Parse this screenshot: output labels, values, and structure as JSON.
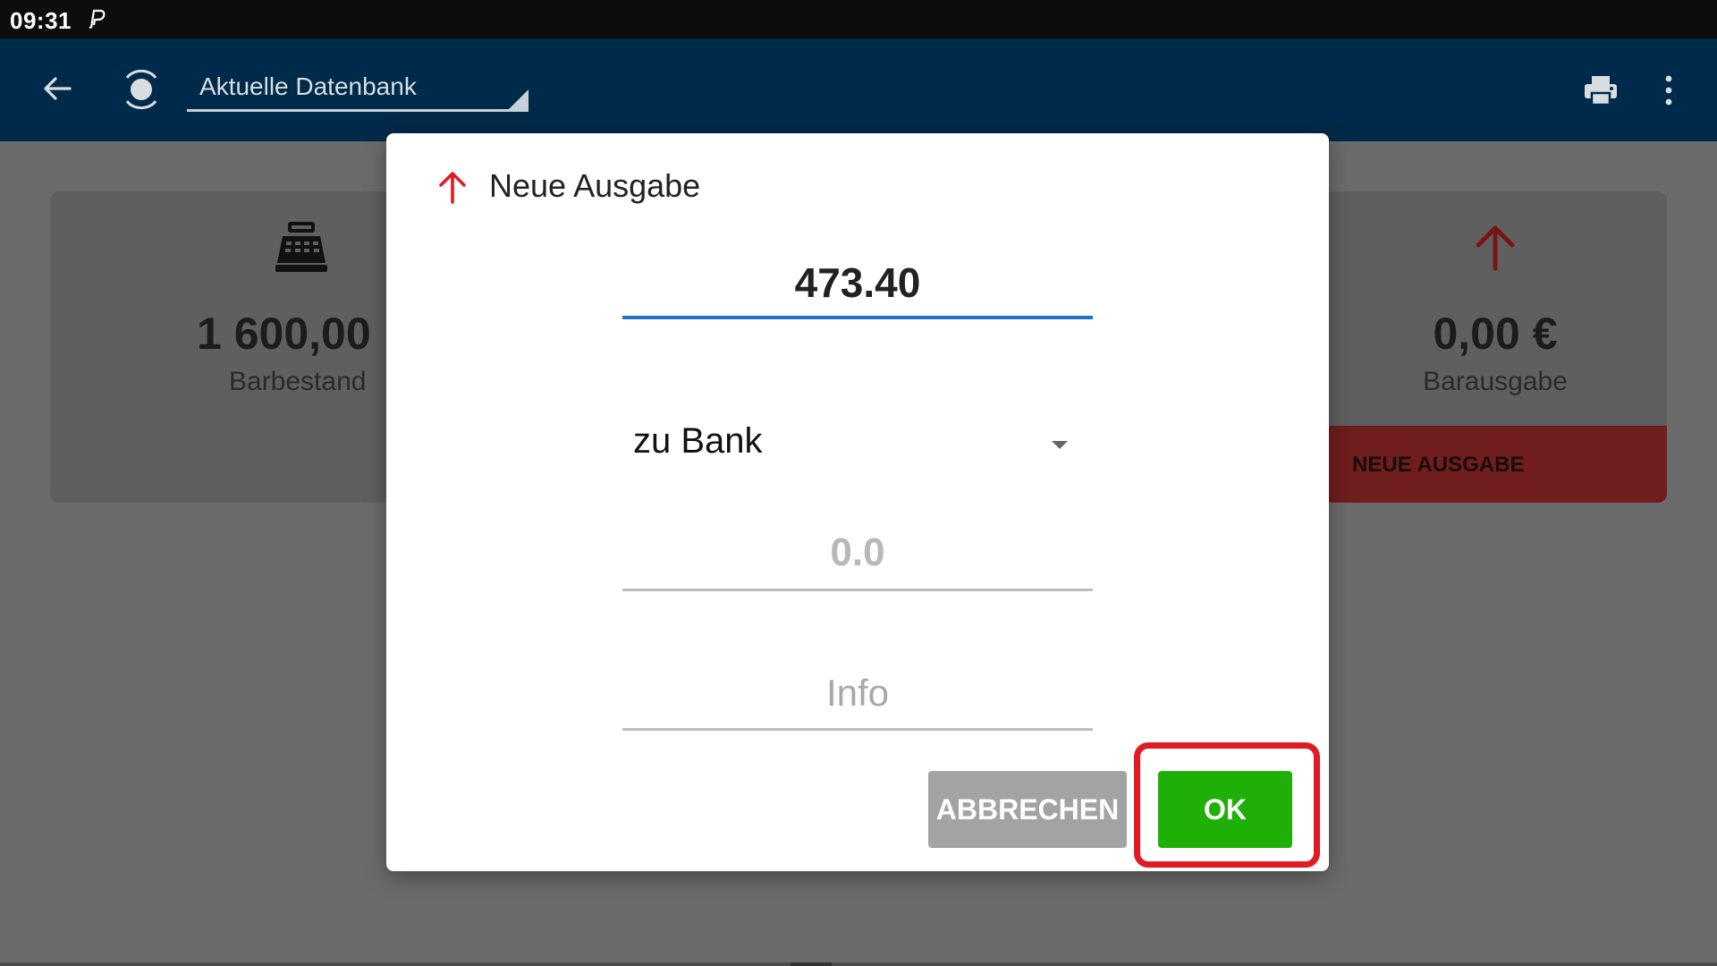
{
  "status_bar": {
    "time": "09:31"
  },
  "app_bar": {
    "database_label": "Aktuelle Datenbank"
  },
  "cards": {
    "left": {
      "amount": "1 600,00",
      "label": "Barbestand"
    },
    "right": {
      "amount": "0,00 €",
      "label": "Barausgabe",
      "action_label": "NEUE AUSGABE"
    }
  },
  "dialog": {
    "title": "Neue Ausgabe",
    "amount_value": "473.40",
    "account_select": "zu Bank",
    "number_placeholder": "0.0",
    "info_placeholder": "Info",
    "cancel_label": "ABBRECHEN",
    "ok_label": "OK"
  },
  "colors": {
    "app_bar": "#002a49",
    "ok_button": "#1fb007",
    "cancel_button": "#a3a3a3",
    "highlight": "#e01b24",
    "expense_arrow": "#e01b24",
    "input_focus": "#1e73c6"
  },
  "icons": {
    "status_notification": "paypal-notification-icon",
    "back": "arrow-back-icon",
    "database": "database-icon",
    "print": "printer-icon",
    "more": "more-vert-icon",
    "cash_register": "cash-register-icon",
    "expense": "arrow-up-icon"
  }
}
